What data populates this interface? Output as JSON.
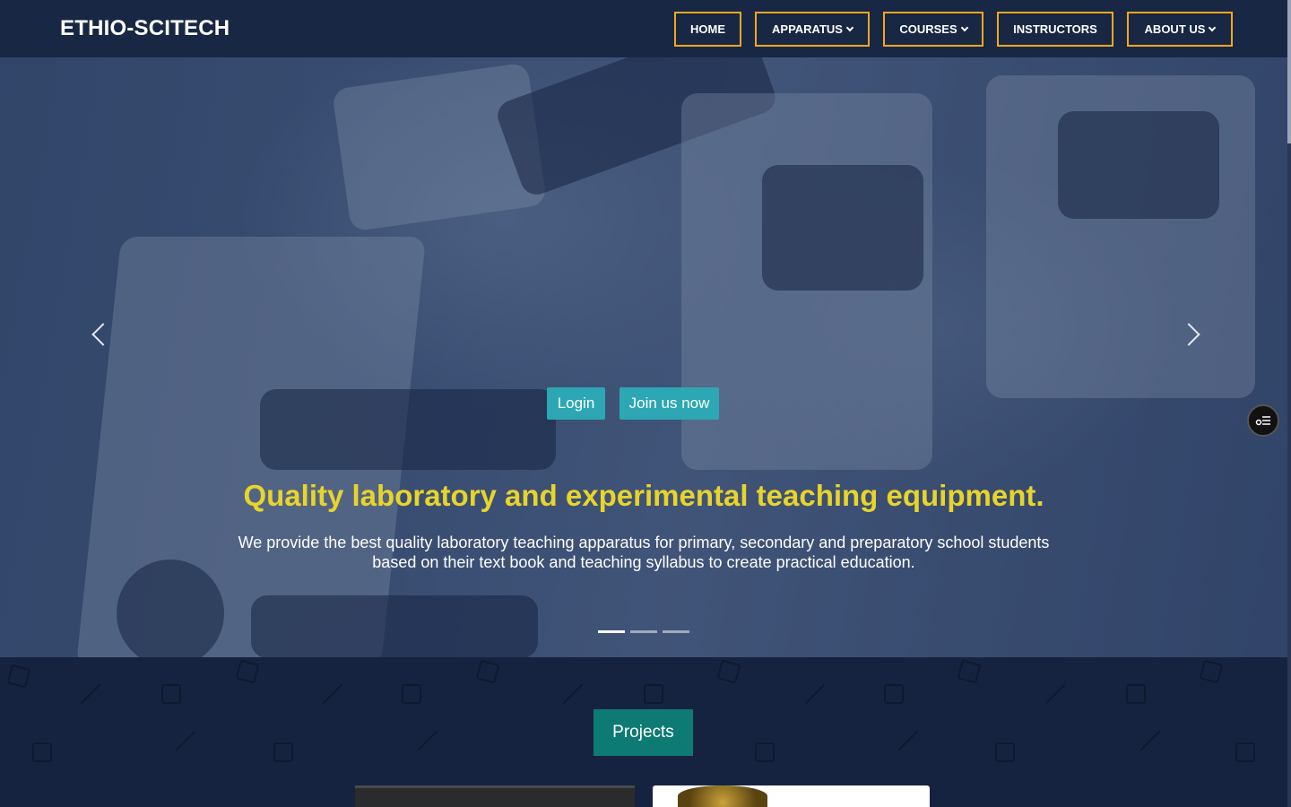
{
  "brand": "ETHIO-SCITECH",
  "nav": {
    "home": "HOME",
    "apparatus": "APPARATUS",
    "courses": "COURSES",
    "instructors": "INSTRUCTORS",
    "about": "ABOUT US"
  },
  "hero": {
    "login": "Login",
    "join": "Join us now",
    "title": "Quality laboratory and experimental teaching equipment.",
    "text": "We provide the best quality laboratory teaching apparatus for primary, secondary and preparatory school students based on their text book and teaching syllabus to create practical education.",
    "slides_total": 3,
    "active_slide": 1
  },
  "projects": {
    "label": "Projects"
  },
  "colors": {
    "nav_border": "#f5a623",
    "hero_button": "#2ca7b3",
    "hero_title": "#e8d42a",
    "projects_button": "#0e7a74",
    "background": "#152341"
  }
}
